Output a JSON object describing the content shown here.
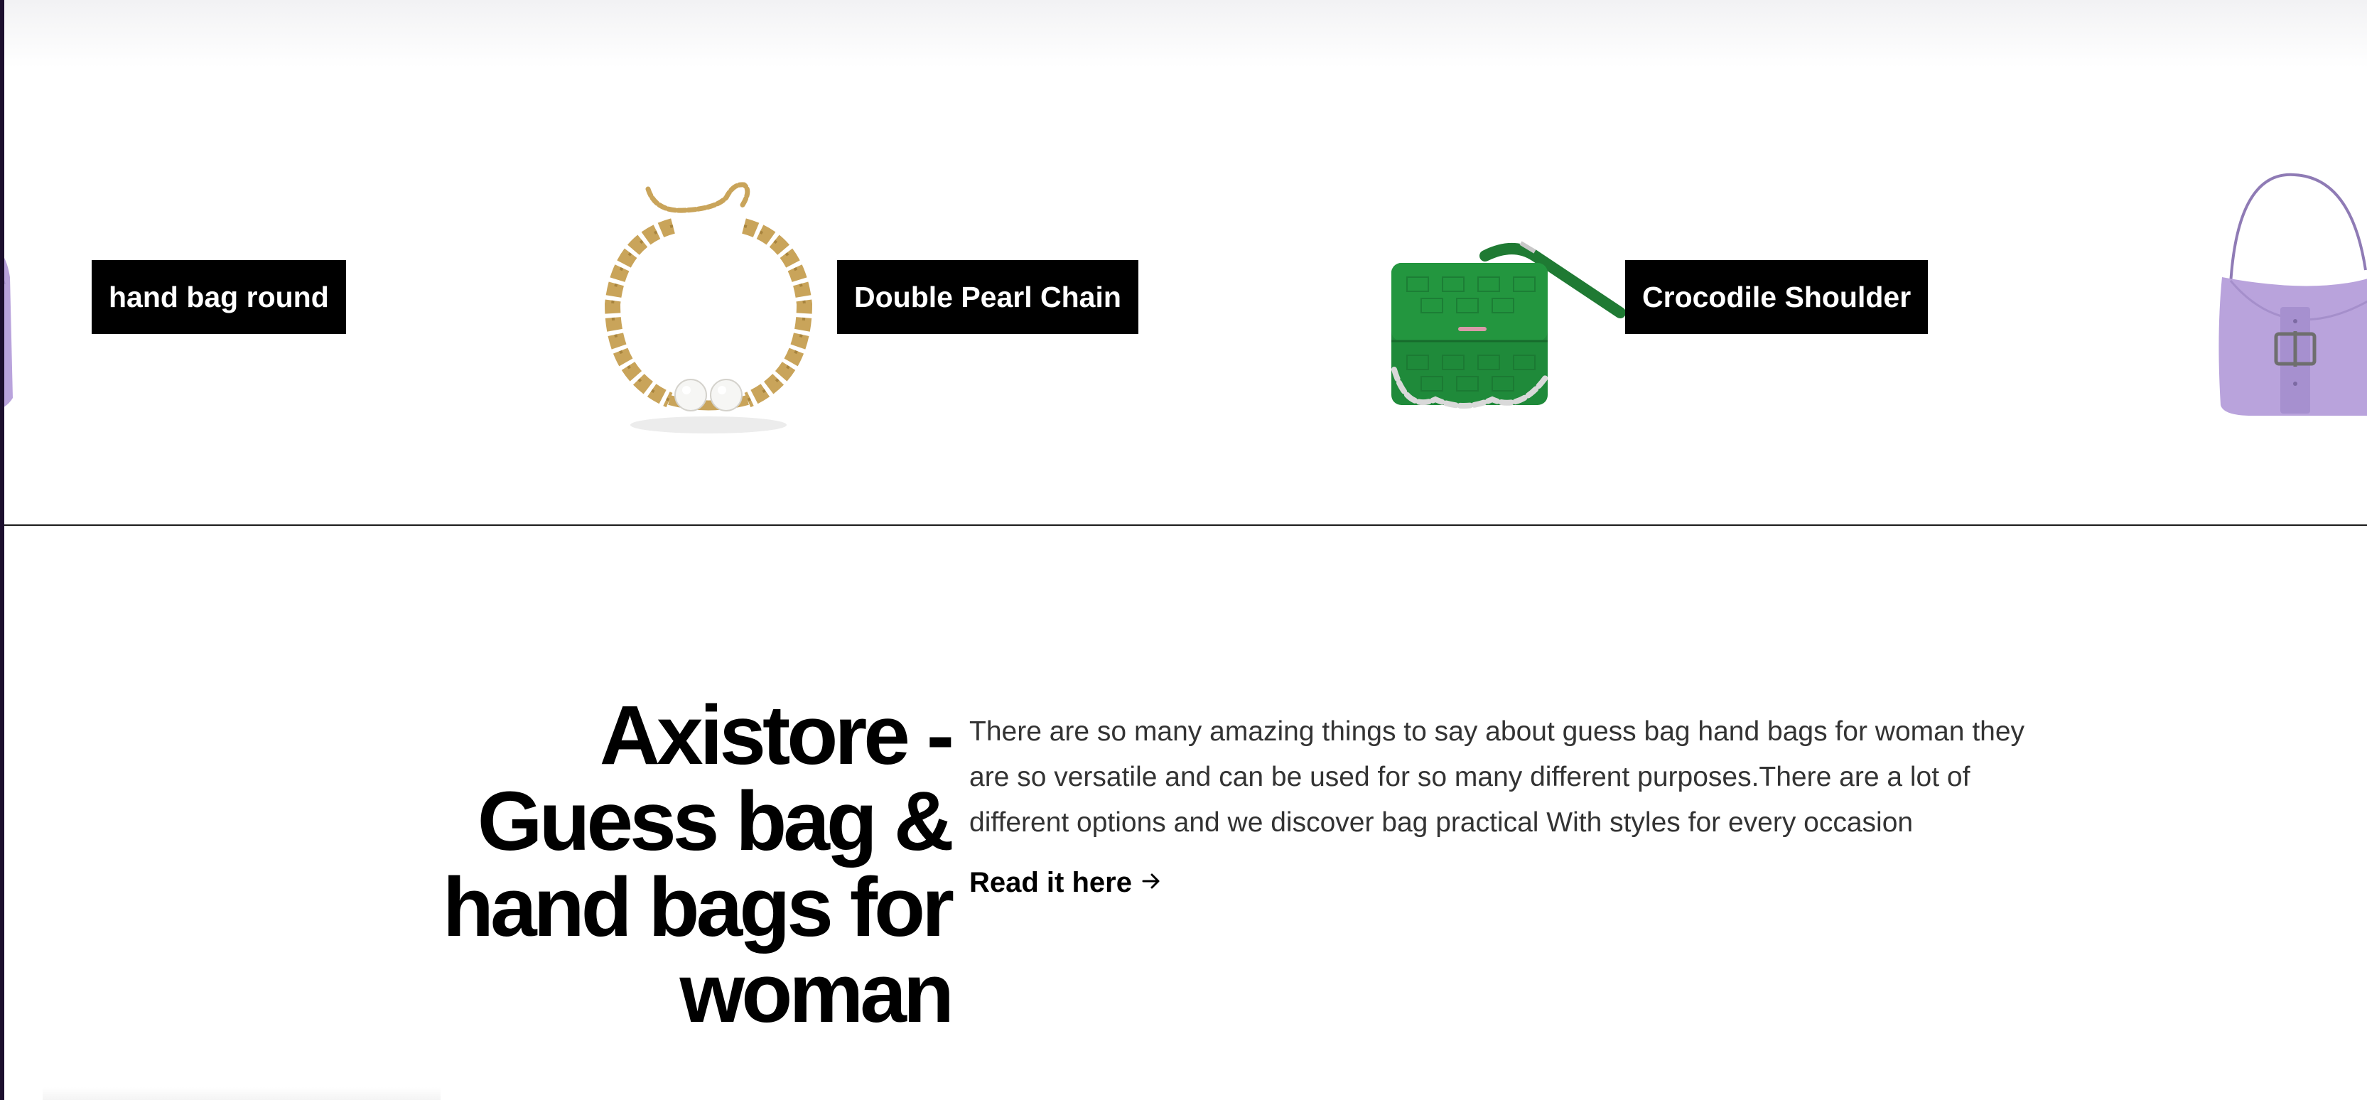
{
  "products": [
    {
      "name": "hand bag round",
      "icon": "purple-handbag-icon"
    },
    {
      "name": "Double Pearl Chain",
      "icon": "pearl-chain-necklace-icon"
    },
    {
      "name": "Crocodile Shoulder",
      "icon": "green-crocodile-bag-icon"
    },
    {
      "name": "",
      "icon": "purple-handbag-icon"
    }
  ],
  "about": {
    "headline": "Axistore - Guess bag & hand bags for woman",
    "description": "There are so many amazing things to say about guess bag hand bags for woman they are so versatile and can be used for so many different purposes.There are a lot of different options and we discover bag practical With styles for every occasion",
    "link_label": "Read it here",
    "link_icon": "arrow-right-icon"
  },
  "colors": {
    "label_bg": "#000000",
    "label_text": "#ffffff",
    "lilac_bag": "#b9a3dc",
    "green_bag": "#1f8a3a",
    "gold_chain": "#c9a45a",
    "body_text": "#333333"
  }
}
